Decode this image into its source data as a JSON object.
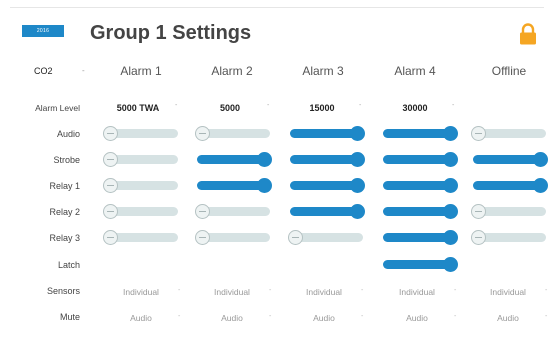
{
  "header": {
    "title": "Group 1 Settings",
    "back_label": "2016",
    "lock_icon": "lock-icon",
    "lock_color": "#f5a623"
  },
  "gas": {
    "value": "CO2",
    "caret": "-"
  },
  "columns": [
    "Alarm 1",
    "Alarm 2",
    "Alarm 3",
    "Alarm 4",
    "Offline"
  ],
  "rows": {
    "alarm_level_label": "Alarm Level",
    "audio_label": "Audio",
    "strobe_label": "Strobe",
    "relay1_label": "Relay 1",
    "relay2_label": "Relay 2",
    "relay3_label": "Relay 3",
    "latch_label": "Latch",
    "sensors_label": "Sensors",
    "mute_label": "Mute"
  },
  "alarm_levels": [
    "5000 TWA",
    "5000",
    "15000",
    "30000"
  ],
  "toggles": {
    "audio": [
      false,
      false,
      true,
      true,
      false
    ],
    "strobe": [
      false,
      true,
      true,
      true,
      true
    ],
    "relay1": [
      false,
      true,
      true,
      true,
      true
    ],
    "relay2": [
      false,
      false,
      true,
      true,
      false
    ],
    "relay3": [
      false,
      false,
      false,
      true,
      false
    ],
    "latch": [
      null,
      null,
      null,
      true,
      null
    ]
  },
  "sensors": [
    "Individual",
    "Individual",
    "Individual",
    "Individual",
    "Individual"
  ],
  "mute": [
    "Audio",
    "Audio",
    "Audio",
    "Audio",
    "Audio"
  ],
  "colors": {
    "accent": "#1e88c8",
    "track_off": "#d6e2e3"
  }
}
